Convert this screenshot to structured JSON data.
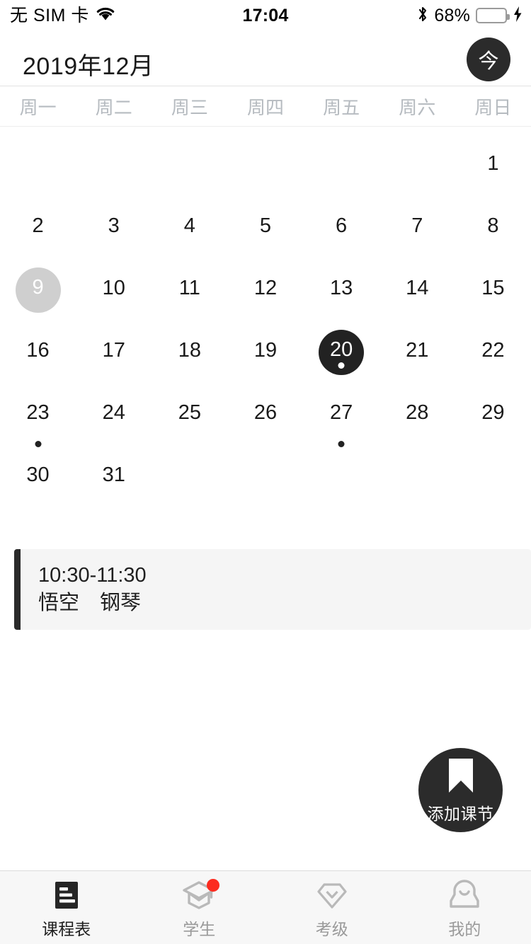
{
  "status_bar": {
    "carrier": "无 SIM 卡",
    "wifi_icon": "wifi-icon",
    "time": "17:04",
    "bluetooth_icon": "bluetooth-icon",
    "battery_percent": "68%",
    "battery_level": 68,
    "battery_color": "#4cd964",
    "charging_icon": "lightning-bolt-icon"
  },
  "header": {
    "month_title": "2019年12月",
    "today_button_label": "今"
  },
  "weekdays": [
    "周一",
    "周二",
    "周三",
    "周四",
    "周五",
    "周六",
    "周日"
  ],
  "calendar": {
    "accent_selected": "#222222",
    "accent_today": "#cfcfcf",
    "rows": [
      [
        {
          "day": "",
          "state": "empty",
          "dot": false
        },
        {
          "day": "",
          "state": "empty",
          "dot": false
        },
        {
          "day": "",
          "state": "empty",
          "dot": false
        },
        {
          "day": "",
          "state": "empty",
          "dot": false
        },
        {
          "day": "",
          "state": "empty",
          "dot": false
        },
        {
          "day": "",
          "state": "empty",
          "dot": false
        },
        {
          "day": "1",
          "state": "normal",
          "dot": false
        }
      ],
      [
        {
          "day": "2",
          "state": "normal",
          "dot": false
        },
        {
          "day": "3",
          "state": "normal",
          "dot": false
        },
        {
          "day": "4",
          "state": "normal",
          "dot": false
        },
        {
          "day": "5",
          "state": "normal",
          "dot": false
        },
        {
          "day": "6",
          "state": "normal",
          "dot": false
        },
        {
          "day": "7",
          "state": "normal",
          "dot": false
        },
        {
          "day": "8",
          "state": "normal",
          "dot": false
        }
      ],
      [
        {
          "day": "9",
          "state": "today",
          "dot": false
        },
        {
          "day": "10",
          "state": "normal",
          "dot": false
        },
        {
          "day": "11",
          "state": "normal",
          "dot": false
        },
        {
          "day": "12",
          "state": "normal",
          "dot": false
        },
        {
          "day": "13",
          "state": "normal",
          "dot": false
        },
        {
          "day": "14",
          "state": "normal",
          "dot": false
        },
        {
          "day": "15",
          "state": "normal",
          "dot": false
        }
      ],
      [
        {
          "day": "16",
          "state": "normal",
          "dot": false
        },
        {
          "day": "17",
          "state": "normal",
          "dot": false
        },
        {
          "day": "18",
          "state": "normal",
          "dot": false
        },
        {
          "day": "19",
          "state": "normal",
          "dot": false
        },
        {
          "day": "20",
          "state": "selected",
          "dot": true
        },
        {
          "day": "21",
          "state": "normal",
          "dot": false
        },
        {
          "day": "22",
          "state": "normal",
          "dot": false
        }
      ],
      [
        {
          "day": "23",
          "state": "normal",
          "dot": true
        },
        {
          "day": "24",
          "state": "normal",
          "dot": false
        },
        {
          "day": "25",
          "state": "normal",
          "dot": false
        },
        {
          "day": "26",
          "state": "normal",
          "dot": false
        },
        {
          "day": "27",
          "state": "normal",
          "dot": true
        },
        {
          "day": "28",
          "state": "normal",
          "dot": false
        },
        {
          "day": "29",
          "state": "normal",
          "dot": false
        }
      ],
      [
        {
          "day": "30",
          "state": "normal",
          "dot": false
        },
        {
          "day": "31",
          "state": "normal",
          "dot": false
        },
        {
          "day": "",
          "state": "empty",
          "dot": false
        },
        {
          "day": "",
          "state": "empty",
          "dot": false
        },
        {
          "day": "",
          "state": "empty",
          "dot": false
        },
        {
          "day": "",
          "state": "empty",
          "dot": false
        },
        {
          "day": "",
          "state": "empty",
          "dot": false
        }
      ]
    ]
  },
  "events": [
    {
      "time": "10:30-11:30",
      "description": "悟空　钢琴",
      "accent_color": "#2a2a2a"
    }
  ],
  "fab": {
    "label": "添加课节",
    "icon": "bookmark-icon",
    "background": "#2b2b2b"
  },
  "tabbar": {
    "badge_color": "#fc2c20",
    "items": [
      {
        "label": "课程表",
        "icon": "schedule-list-icon",
        "active": true,
        "badge": false
      },
      {
        "label": "学生",
        "icon": "graduation-cap-icon",
        "active": false,
        "badge": true
      },
      {
        "label": "考级",
        "icon": "diamond-icon",
        "active": false,
        "badge": false
      },
      {
        "label": "我的",
        "icon": "user-avatar-icon",
        "active": false,
        "badge": false
      }
    ]
  }
}
